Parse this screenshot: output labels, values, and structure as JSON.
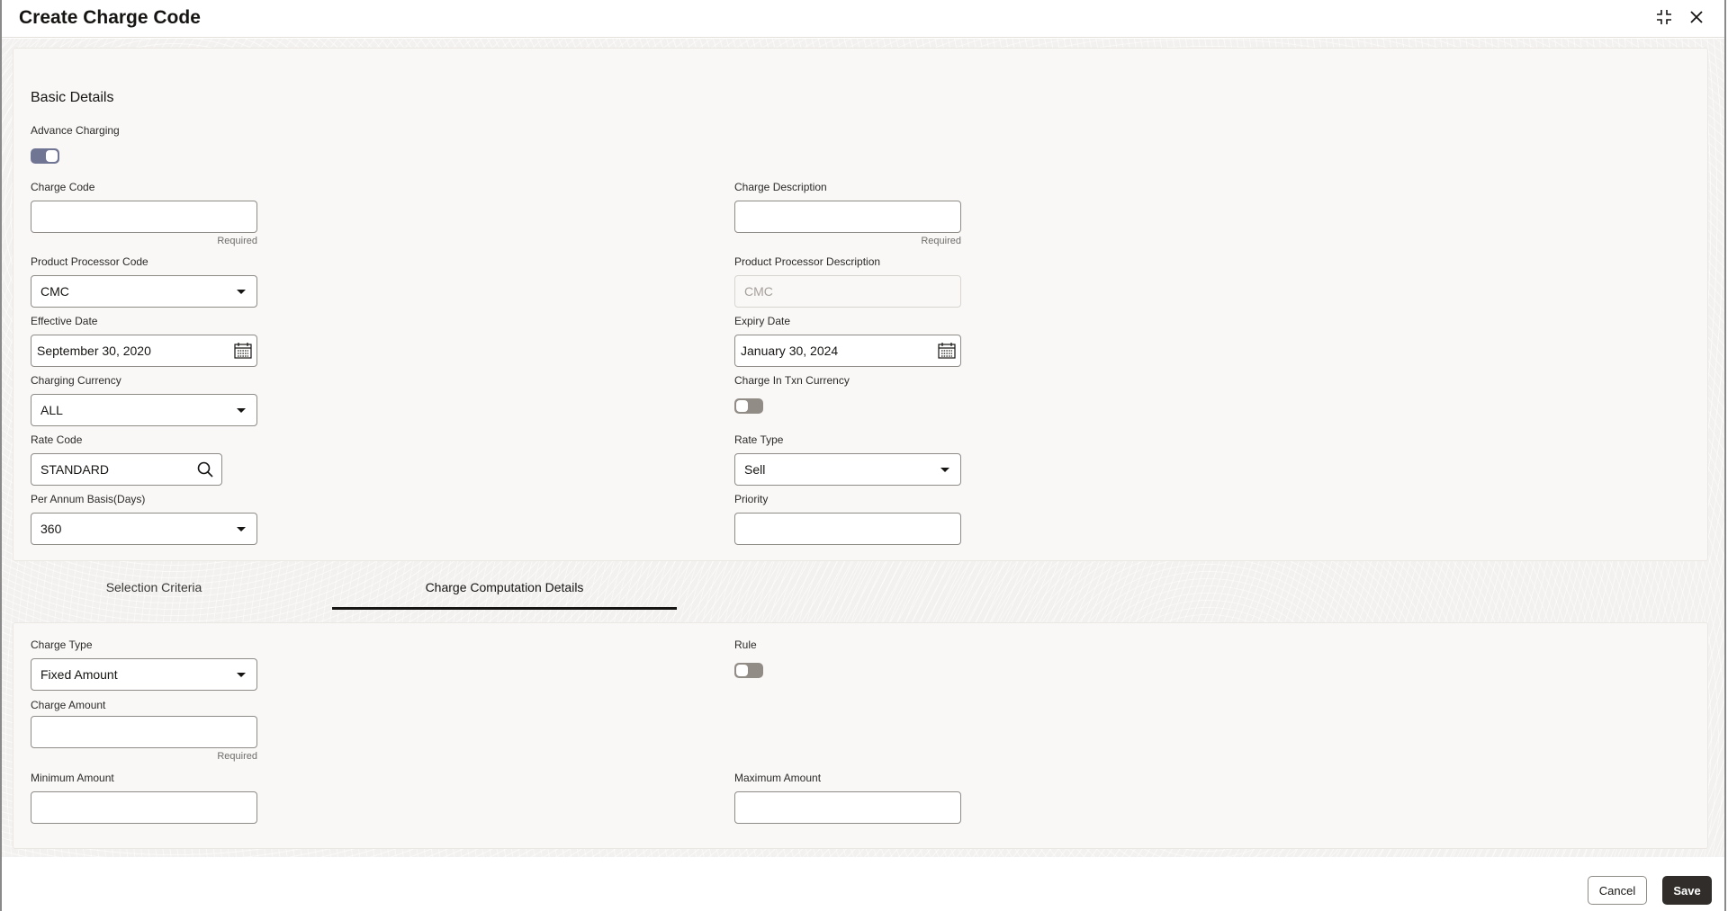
{
  "window": {
    "title": "Create Charge Code",
    "icons": [
      "collapse-icon",
      "close-icon"
    ]
  },
  "basic_details": {
    "section_title": "Basic Details",
    "advance_charging": {
      "label": "Advance Charging",
      "state": "on"
    },
    "charge_code": {
      "label": "Charge Code",
      "value": "",
      "hint": "Required"
    },
    "charge_description": {
      "label": "Charge Description",
      "value": "",
      "hint": "Required"
    },
    "product_processor_code": {
      "label": "Product Processor Code",
      "value": "CMC"
    },
    "product_processor_description": {
      "label": "Product Processor Description",
      "value": "CMC"
    },
    "effective_date": {
      "label": "Effective Date",
      "value": "September 30, 2020"
    },
    "expiry_date": {
      "label": "Expiry Date",
      "value": "January 30, 2024"
    },
    "charging_currency": {
      "label": "Charging Currency",
      "value": "ALL"
    },
    "charge_in_txn_currency": {
      "label": "Charge In Txn Currency",
      "state": "off"
    },
    "rate_code": {
      "label": "Rate Code",
      "value": "STANDARD"
    },
    "rate_type": {
      "label": "Rate Type",
      "value": "Sell"
    },
    "per_annum_basis": {
      "label": "Per Annum Basis(Days)",
      "value": "360"
    },
    "priority": {
      "label": "Priority",
      "value": ""
    }
  },
  "tabs": [
    {
      "label": "Selection Criteria",
      "active": false
    },
    {
      "label": "Charge Computation Details",
      "active": true
    }
  ],
  "charge_computation": {
    "charge_type": {
      "label": "Charge Type",
      "value": "Fixed Amount"
    },
    "rule": {
      "label": "Rule",
      "state": "off"
    },
    "charge_amount": {
      "label": "Charge Amount",
      "value": "",
      "hint": "Required"
    },
    "minimum_amount": {
      "label": "Minimum Amount",
      "value": ""
    },
    "maximum_amount": {
      "label": "Maximum Amount",
      "value": ""
    }
  },
  "footer": {
    "cancel_label": "Cancel",
    "save_label": "Save"
  }
}
